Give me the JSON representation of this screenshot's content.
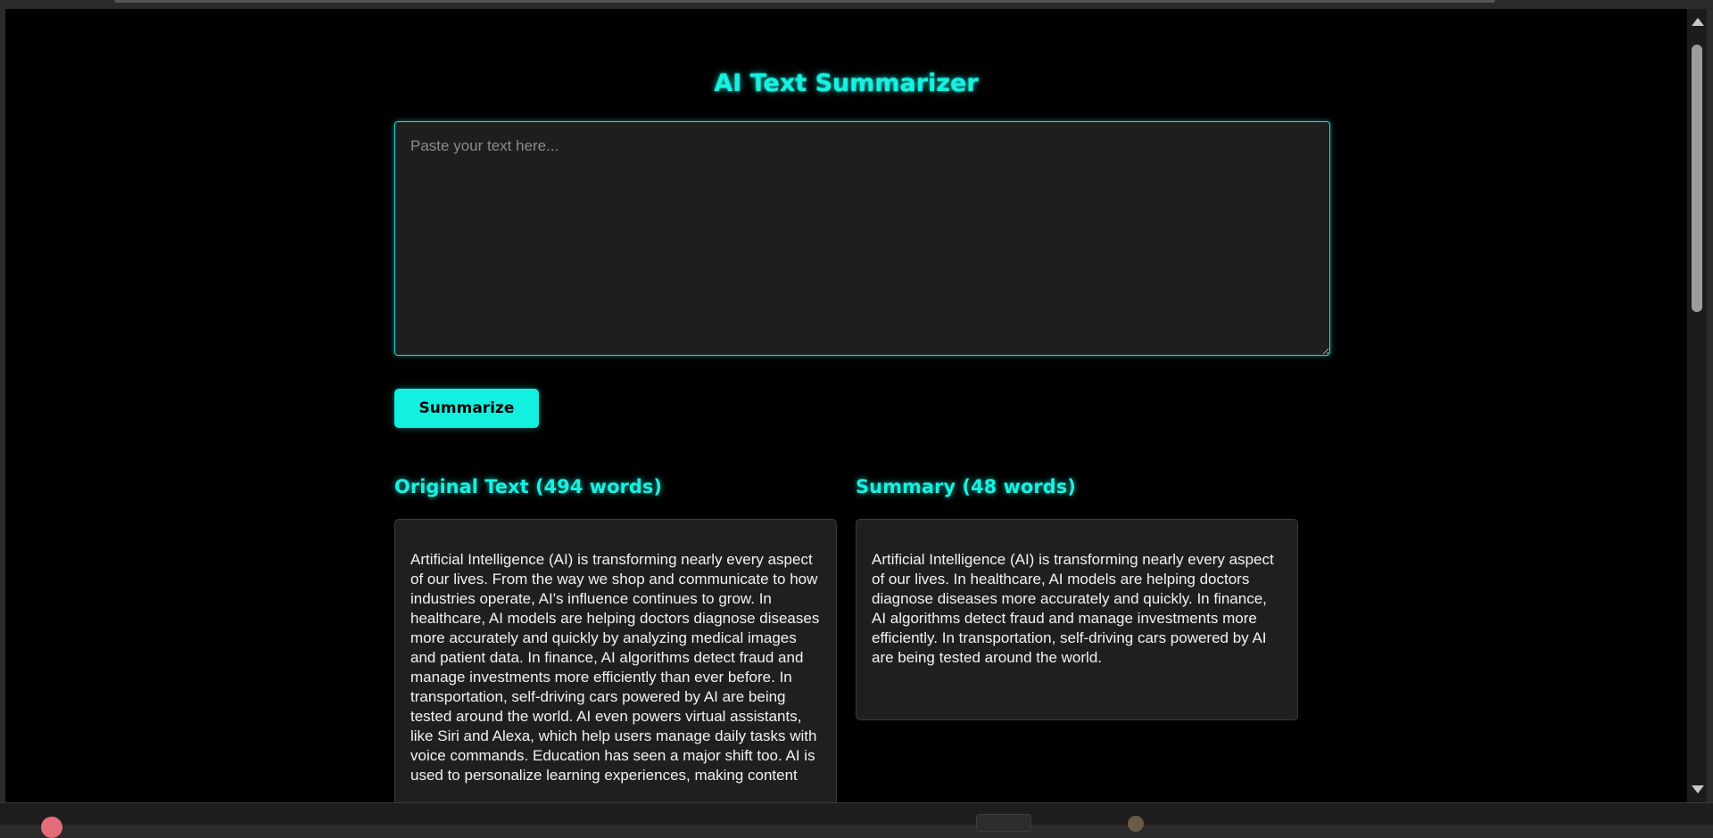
{
  "app": {
    "title": "AI Text Summarizer"
  },
  "input": {
    "placeholder": "Paste your text here...",
    "value": ""
  },
  "actions": {
    "summarize_label": "Summarize"
  },
  "original": {
    "heading": "Original Text (494 words)",
    "word_count": 494,
    "text": "Artificial Intelligence (AI) is transforming nearly every aspect of our lives. From the way we shop and communicate to how industries operate, AI's influence continues to grow. In healthcare, AI models are helping doctors diagnose diseases more accurately and quickly by analyzing medical images and patient data. In finance, AI algorithms detect fraud and manage investments more efficiently than ever before. In transportation, self-driving cars powered by AI are being tested around the world. AI even powers virtual assistants, like Siri and Alexa, which help users manage daily tasks with voice commands. Education has seen a major shift too. AI is used to personalize learning experiences, making content"
  },
  "summary": {
    "heading": "Summary (48 words)",
    "word_count": 48,
    "text": "Artificial Intelligence (AI) is transforming nearly every aspect of our lives. In healthcare, AI models are helping doctors diagnose diseases more accurately and quickly. In finance, AI algorithms detect fraud and manage investments more efficiently. In transportation, self-driving cars powered by AI are being tested around the world."
  },
  "colors": {
    "accent": "#19f0e0",
    "background": "#000000",
    "panel": "#1f1f1f"
  }
}
